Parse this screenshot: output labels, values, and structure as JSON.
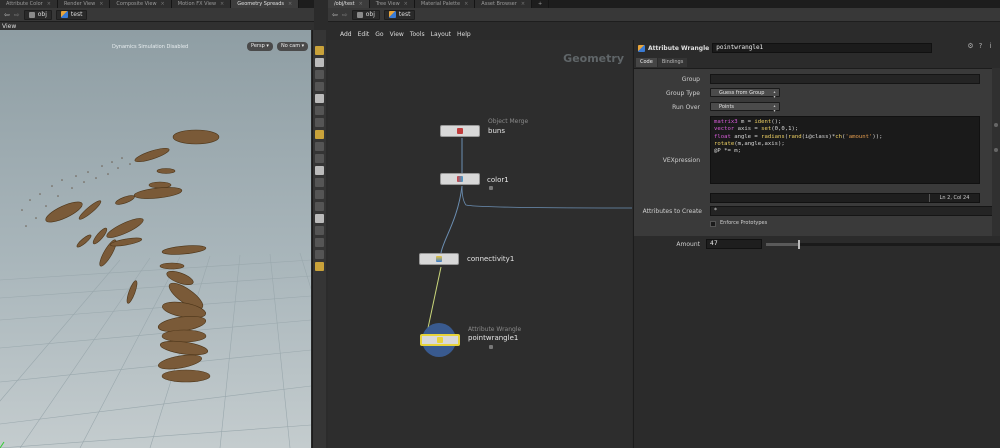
{
  "left_tabs": [
    "Attribute Color",
    "Render View",
    "Composite View",
    "Motion FX View",
    "Geometry Spreads"
  ],
  "left_path": {
    "obj": "obj",
    "geo": "test"
  },
  "viewport": {
    "label": "View",
    "status_text": "Dynamics Simulation Disabled",
    "persp_label": "Persp ▾",
    "cam_label": "No cam ▾"
  },
  "right_tabs": [
    "/obj/test",
    "Tree View",
    "Material Palette",
    "Asset Browser"
  ],
  "right_path": {
    "obj": "obj",
    "geo": "test"
  },
  "menu": [
    "Add",
    "Edit",
    "Go",
    "View",
    "Tools",
    "Layout",
    "Help"
  ],
  "network": {
    "context_label": "Geometry",
    "nodes": [
      {
        "type": "Object Merge",
        "name": "buns"
      },
      {
        "type": "",
        "name": "color1"
      },
      {
        "type": "",
        "name": "connectivity1"
      },
      {
        "type": "Attribute Wrangle",
        "name": "pointwrangle1"
      }
    ]
  },
  "params": {
    "node_type": "Attribute Wrangle",
    "node_name": "pointwrangle1",
    "tabs": [
      "Code",
      "Bindings"
    ],
    "labels": {
      "group": "Group",
      "group_type": "Group Type",
      "run_over": "Run Over",
      "vexpression": "VEXpression",
      "attributes_to_create": "Attributes to Create",
      "enforce_prototypes": "Enforce Prototypes",
      "amount": "Amount"
    },
    "group_value": "",
    "group_type_value": "Guess from Group",
    "run_over_value": "Points",
    "code_lines": [
      "matrix3 m = ident();",
      "vector axis = set(0,0,1);",
      "float angle = radians(rand(i@class)*ch('amount'));",
      "rotate(m,angle,axis);",
      "@P *= m;"
    ],
    "cursor_status": "Ln 2, Col 24",
    "attributes_to_create_value": "*",
    "enforce_prototypes": false,
    "amount_value": "47",
    "amount_fraction": 0.14
  }
}
